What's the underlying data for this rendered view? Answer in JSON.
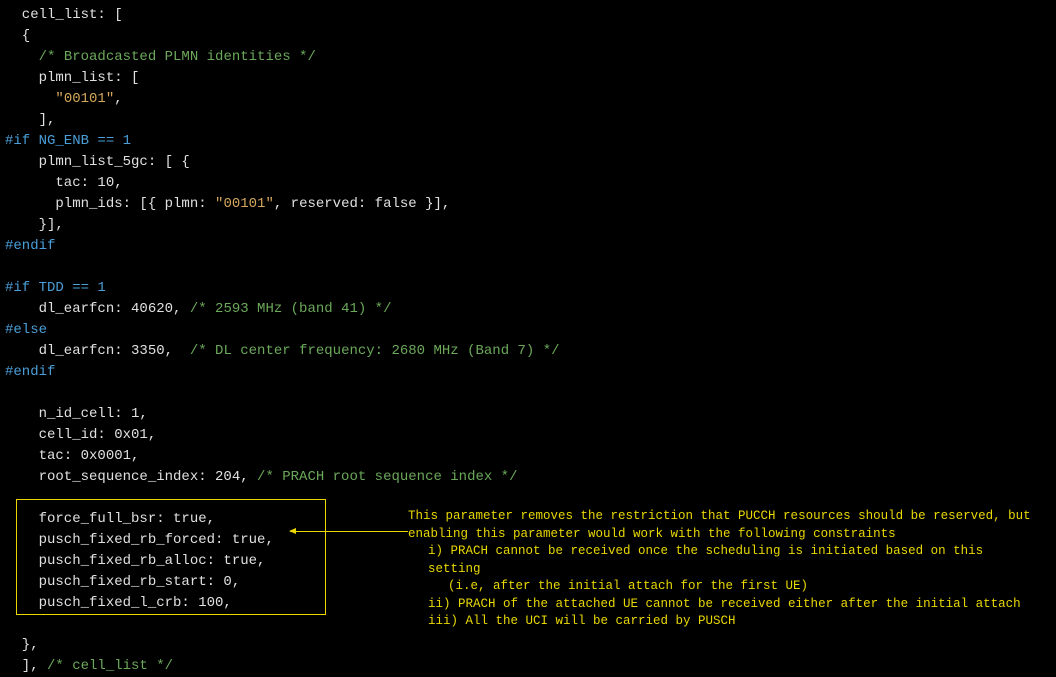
{
  "code": {
    "line1": "  cell_list: [",
    "line2": "  {",
    "line3_indent": "    ",
    "line3_comment": "/* Broadcasted PLMN identities */",
    "line4": "    plmn_list: [",
    "line5_indent": "      ",
    "line5_string": "\"00101\"",
    "line5_end": ",",
    "line6": "    ],",
    "line7_keyword": "#if NG_ENB == 1",
    "line8": "    plmn_list_5gc: [ {",
    "line9": "      tac: 10,",
    "line10_a": "      plmn_ids: [{ plmn: ",
    "line10_str": "\"00101\"",
    "line10_b": ", reserved: false }],",
    "line11": "    }],",
    "line12_keyword": "#endif",
    "line13": "",
    "line14_keyword": "#if TDD == 1",
    "line15_a": "    dl_earfcn: 40620, ",
    "line15_comment": "/* 2593 MHz (band 41) */",
    "line16_keyword": "#else",
    "line17_a": "    dl_earfcn: 3350,  ",
    "line17_comment": "/* DL center frequency: 2680 MHz (Band 7) */",
    "line18_keyword": "#endif",
    "line19": "",
    "line20": "    n_id_cell: 1,",
    "line21": "    cell_id: 0x01,",
    "line22": "    tac: 0x0001,",
    "line23_a": "    root_sequence_index: 204, ",
    "line23_comment": "/* PRACH root sequence index */",
    "line24": "",
    "line25": "    force_full_bsr: true,",
    "line26": "    pusch_fixed_rb_forced: true,",
    "line27": "    pusch_fixed_rb_alloc: true,",
    "line28": "    pusch_fixed_rb_start: 0,",
    "line29": "    pusch_fixed_l_crb: 100,",
    "line30": "",
    "line31": "  },",
    "line32_a": "  ], ",
    "line32_comment": "/* cell_list */"
  },
  "annotation": {
    "l1": "This parameter removes the restriction that PUCCH resources should be reserved, but",
    "l2": "enabling this parameter would work with the following constraints",
    "l3": "i) PRACH cannot be received once the scheduling is initiated based on this setting",
    "l4": "(i.e, after the initial attach for the first UE)",
    "l5": "ii) PRACH of the attached UE cannot be received either after the initial attach",
    "l6": "iii) All the UCI will be carried by PUSCH"
  }
}
